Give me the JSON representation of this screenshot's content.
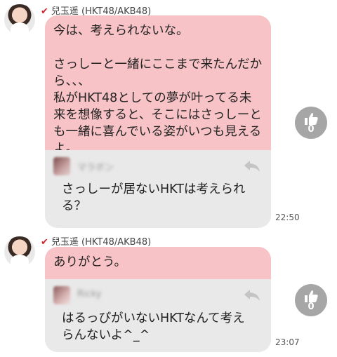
{
  "messages": [
    {
      "sender": "兒玉遥 (HKT48/AKB48)",
      "text": "今は、考えられないな。\n\nさっしーと一緒にここまで来たんだから、、、\n私がHKT48としての夢が叶ってる未来を想像すると、そこにはさっしーとも一緒に喜んでいる姿がいつも見えるよ。",
      "quote_name": "マラボン",
      "quote_text": "さっしーが居ないHKTは考えられ\nる？",
      "time": "22:50",
      "likes": "0"
    },
    {
      "sender": "兒玉遥 (HKT48/AKB48)",
      "text": "ありがとう。",
      "quote_name": "Ricky",
      "quote_text": "はるっぴがいないHKTなんて考え\nらんないよ^_^",
      "time": "23:07",
      "likes": "0"
    }
  ],
  "colors": {
    "bubble_pink": "#f8c3c6",
    "bubble_gray": "#e9e9e9",
    "like_gray": "#a6a6a6",
    "check_red": "#d2232a"
  },
  "icons": {
    "verified": "check-icon",
    "reply": "reply-arrow-icon",
    "like": "thumbs-up-icon"
  }
}
